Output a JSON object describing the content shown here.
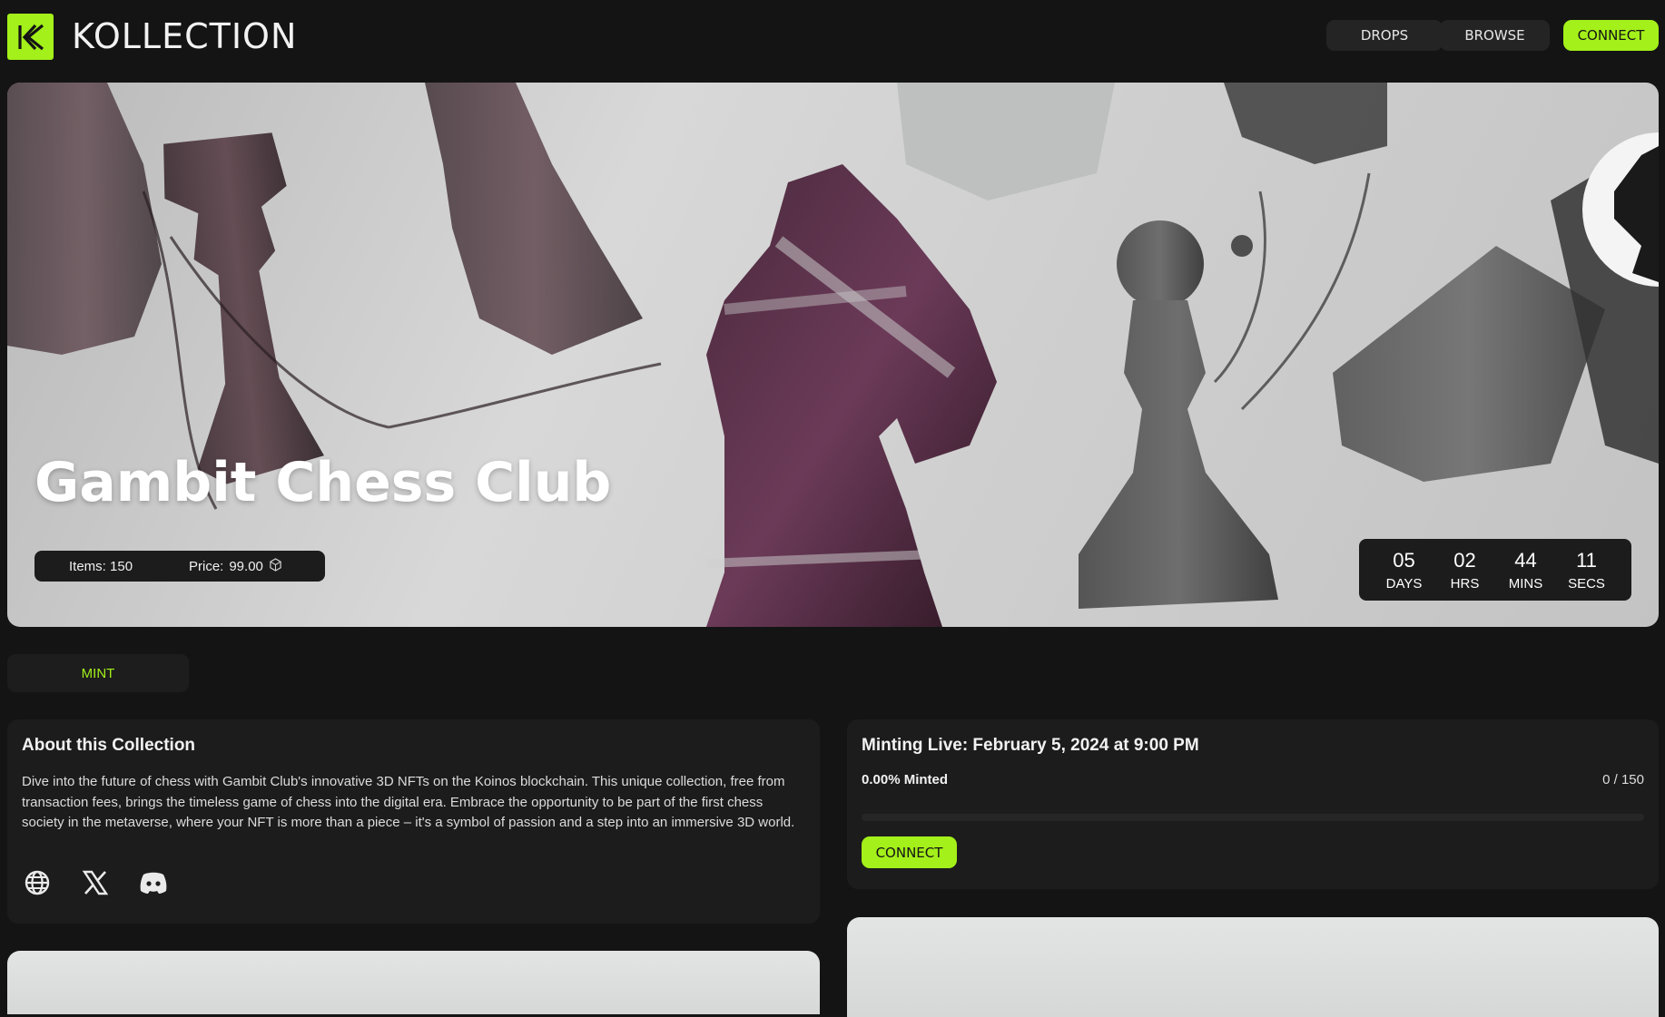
{
  "header": {
    "brand": "KOLLECTION",
    "nav": {
      "drops": "DROPS",
      "browse": "BROWSE",
      "connect": "CONNECT"
    },
    "accent_color": "#a3f01a"
  },
  "hero": {
    "title": "Gambit Chess Club",
    "items_label": "Items: 150",
    "price_label": "Price:",
    "price_value": "99.00",
    "price_icon": "koinos-token-icon",
    "countdown": [
      {
        "value": "05",
        "label": "DAYS"
      },
      {
        "value": "02",
        "label": "HRS"
      },
      {
        "value": "44",
        "label": "MINS"
      },
      {
        "value": "11",
        "label": "SECS"
      }
    ]
  },
  "tabs": {
    "mint": "MINT"
  },
  "about": {
    "title": "About this Collection",
    "description": "Dive into the future of chess with Gambit Club's innovative 3D NFTs on the Koinos blockchain. This unique collection, free from transaction fees, brings the timeless game of chess into the digital era. Embrace the opportunity to be part of the first chess society in the metaverse, where your NFT is more than a piece – it's a symbol of passion and a step into an immersive 3D world.",
    "socials": [
      "globe-icon",
      "x-twitter-icon",
      "discord-icon"
    ]
  },
  "minting": {
    "title": "Minting Live: February 5, 2024 at 9:00 PM",
    "minted_label": "0.00% Minted",
    "minted_count": "0 / 150",
    "progress_fraction": 0.0,
    "connect_label": "CONNECT"
  }
}
